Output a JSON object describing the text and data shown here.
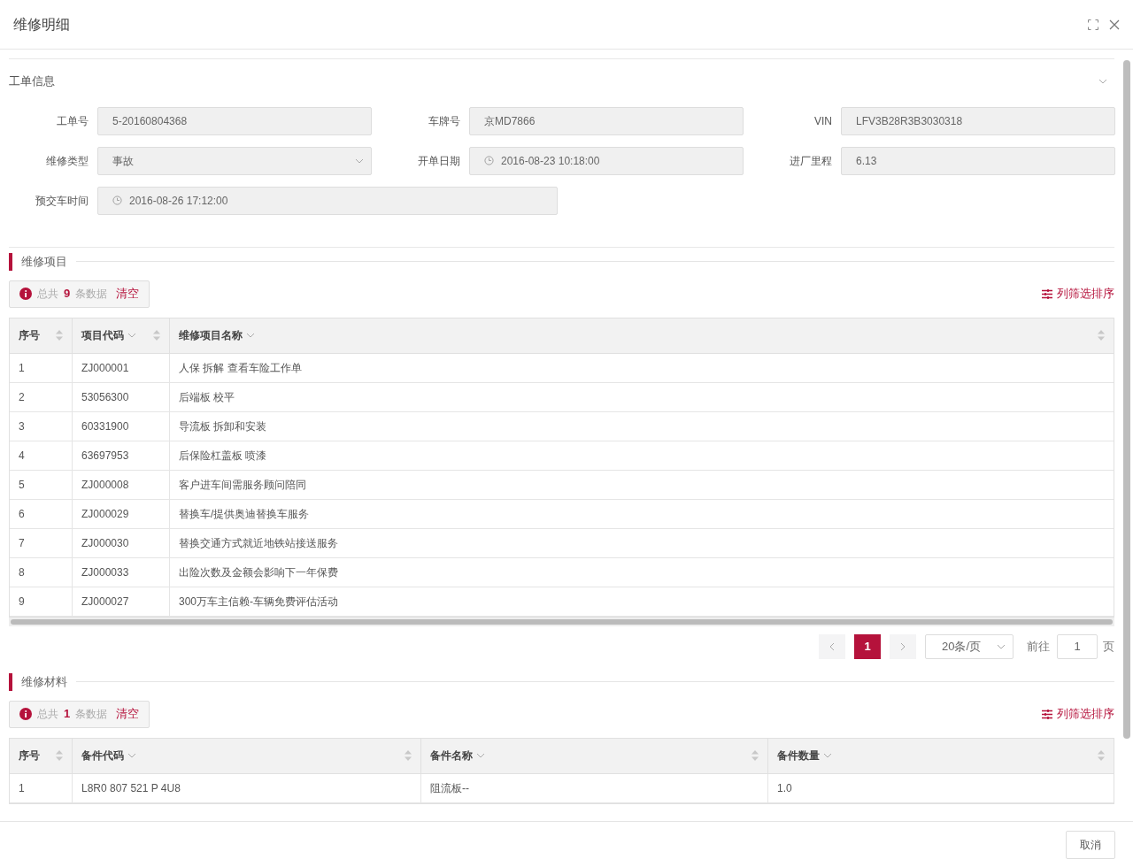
{
  "dialog": {
    "title": "维修明细"
  },
  "work_order": {
    "title": "工单信息",
    "expanded": true,
    "fields": [
      {
        "label": "工单号",
        "value": "5-20160804368",
        "kind": "text"
      },
      {
        "label": "车牌号",
        "value": "京MD7866",
        "kind": "text"
      },
      {
        "label": "VIN",
        "value": "LFV3B28R3B3030318",
        "kind": "text"
      },
      {
        "label": "维修类型",
        "value": "事故",
        "kind": "select"
      },
      {
        "label": "开单日期",
        "value": "2016-08-23 10:18:00",
        "kind": "datetime"
      },
      {
        "label": "进厂里程",
        "value": "6.13",
        "kind": "text"
      },
      {
        "label": "预交车时间",
        "value": "2016-08-26 17:12:00",
        "kind": "datetime_wide"
      }
    ]
  },
  "repair_items": {
    "title": "维修项目",
    "summary": {
      "prefix": "总共",
      "count": "9",
      "suffix": "条数据",
      "clear": "清空"
    },
    "column_settings": "列筛选排序",
    "columns": [
      {
        "label": "序号",
        "sortable": true,
        "filterable": false
      },
      {
        "label": "项目代码",
        "sortable": true,
        "filterable": true
      },
      {
        "label": "维修项目名称",
        "sortable": true,
        "filterable": true
      }
    ],
    "rows": [
      [
        "1",
        "ZJ000001",
        "人保 拆解 查看车险工作单"
      ],
      [
        "2",
        "53056300",
        "后端板 校平"
      ],
      [
        "3",
        "60331900",
        "导流板 拆卸和安装"
      ],
      [
        "4",
        "63697953",
        "后保险杠盖板 喷漆"
      ],
      [
        "5",
        "ZJ000008",
        "客户进车间需服务顾问陪同"
      ],
      [
        "6",
        "ZJ000029",
        "替换车/提供奥迪替换车服务"
      ],
      [
        "7",
        "ZJ000030",
        "替换交通方式就近地铁站接送服务"
      ],
      [
        "8",
        "ZJ000033",
        "出险次数及金额会影响下一年保费"
      ],
      [
        "9",
        "ZJ000027",
        "300万车主信赖-车辆免费评估活动"
      ]
    ],
    "pagination": {
      "pages": [
        {
          "label": "1",
          "selected": true
        }
      ],
      "page_size": "20条/页",
      "goto_label": "前往",
      "goto_value": "1",
      "page_unit": "页"
    }
  },
  "materials": {
    "title": "维修材料",
    "summary": {
      "prefix": "总共",
      "count": "1",
      "suffix": "条数据",
      "clear": "清空"
    },
    "column_settings": "列筛选排序",
    "columns": [
      {
        "label": "序号",
        "sortable": true,
        "filterable": false
      },
      {
        "label": "备件代码",
        "sortable": true,
        "filterable": true
      },
      {
        "label": "备件名称",
        "sortable": true,
        "filterable": true
      },
      {
        "label": "备件数量",
        "sortable": true,
        "filterable": true
      }
    ],
    "rows": [
      [
        "1",
        "L8R0 807 521 P 4U8",
        "阻流板--",
        "1.0"
      ]
    ]
  },
  "footer": {
    "cancel": "取消"
  }
}
